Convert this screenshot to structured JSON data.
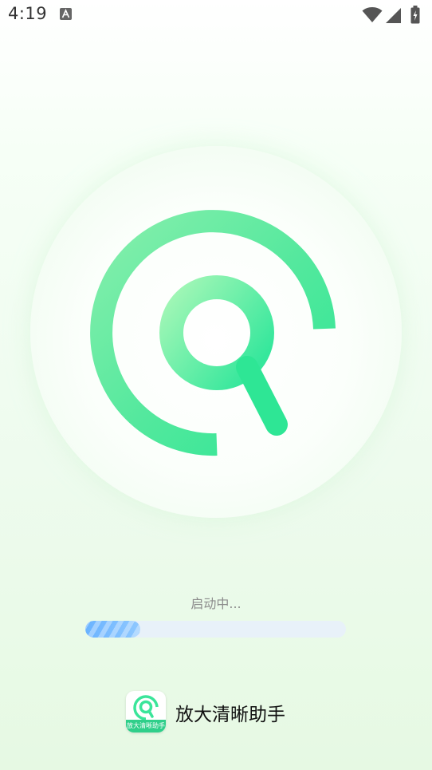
{
  "status_bar": {
    "time": "4:19",
    "icons": [
      "a-notification-icon",
      "wifi-icon",
      "cellular-signal-icon",
      "battery-charging-icon"
    ]
  },
  "splash": {
    "logo_icon": "magnifier-logo-icon",
    "loading_text": "启动中...",
    "progress": 0.21
  },
  "brand": {
    "app_name": "放大清晰助手",
    "icon_caption": "放大清晰助手"
  },
  "colors": {
    "logo_green_light": "#9af5b3",
    "logo_green": "#2ee695",
    "progress_blue": "#7ab9ff",
    "progress_track": "#e8f1f9"
  }
}
